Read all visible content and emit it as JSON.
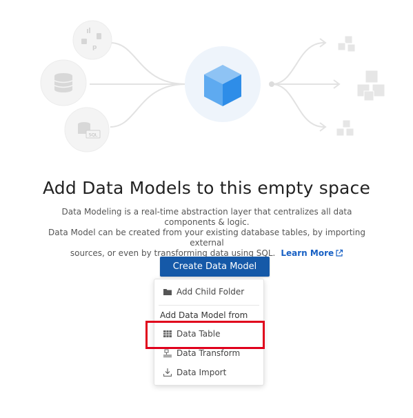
{
  "title": "Add Data Models to this empty space",
  "description": {
    "line1": "Data Modeling is a real-time abstraction layer that centralizes all data components & logic.",
    "line2": "Data Model can be created from your existing database tables, by importing external",
    "line3": "sources, or even by transforming data using SQL.",
    "learn_more": "Learn More"
  },
  "create_button": "Create Data Model",
  "menu": {
    "add_child_folder": "Add Child Folder",
    "section_label": "Add Data Model from",
    "items": [
      {
        "label": "Data Table",
        "icon": "table-icon"
      },
      {
        "label": "Data Transform",
        "icon": "transform-icon"
      },
      {
        "label": "Data Import",
        "icon": "import-icon"
      }
    ]
  },
  "illustration": {
    "source_badge": "SQL"
  },
  "colors": {
    "primary": "#1559a8",
    "link": "#1760c4",
    "highlight": "#e0001b",
    "cube": "#2e8de8"
  }
}
